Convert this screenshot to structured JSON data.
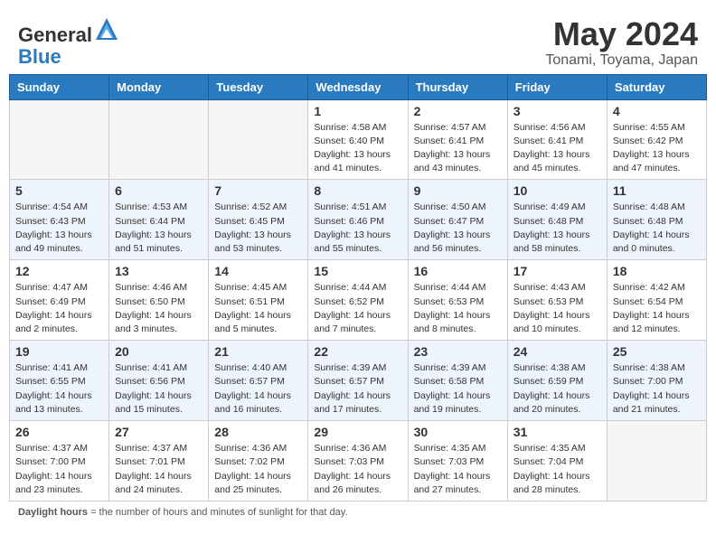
{
  "header": {
    "logo_line1": "General",
    "logo_line2": "Blue",
    "month": "May 2024",
    "location": "Tonami, Toyama, Japan"
  },
  "weekdays": [
    "Sunday",
    "Monday",
    "Tuesday",
    "Wednesday",
    "Thursday",
    "Friday",
    "Saturday"
  ],
  "weeks": [
    [
      {
        "day": "",
        "info": ""
      },
      {
        "day": "",
        "info": ""
      },
      {
        "day": "",
        "info": ""
      },
      {
        "day": "1",
        "info": "Sunrise: 4:58 AM\nSunset: 6:40 PM\nDaylight: 13 hours\nand 41 minutes."
      },
      {
        "day": "2",
        "info": "Sunrise: 4:57 AM\nSunset: 6:41 PM\nDaylight: 13 hours\nand 43 minutes."
      },
      {
        "day": "3",
        "info": "Sunrise: 4:56 AM\nSunset: 6:41 PM\nDaylight: 13 hours\nand 45 minutes."
      },
      {
        "day": "4",
        "info": "Sunrise: 4:55 AM\nSunset: 6:42 PM\nDaylight: 13 hours\nand 47 minutes."
      }
    ],
    [
      {
        "day": "5",
        "info": "Sunrise: 4:54 AM\nSunset: 6:43 PM\nDaylight: 13 hours\nand 49 minutes."
      },
      {
        "day": "6",
        "info": "Sunrise: 4:53 AM\nSunset: 6:44 PM\nDaylight: 13 hours\nand 51 minutes."
      },
      {
        "day": "7",
        "info": "Sunrise: 4:52 AM\nSunset: 6:45 PM\nDaylight: 13 hours\nand 53 minutes."
      },
      {
        "day": "8",
        "info": "Sunrise: 4:51 AM\nSunset: 6:46 PM\nDaylight: 13 hours\nand 55 minutes."
      },
      {
        "day": "9",
        "info": "Sunrise: 4:50 AM\nSunset: 6:47 PM\nDaylight: 13 hours\nand 56 minutes."
      },
      {
        "day": "10",
        "info": "Sunrise: 4:49 AM\nSunset: 6:48 PM\nDaylight: 13 hours\nand 58 minutes."
      },
      {
        "day": "11",
        "info": "Sunrise: 4:48 AM\nSunset: 6:48 PM\nDaylight: 14 hours\nand 0 minutes."
      }
    ],
    [
      {
        "day": "12",
        "info": "Sunrise: 4:47 AM\nSunset: 6:49 PM\nDaylight: 14 hours\nand 2 minutes."
      },
      {
        "day": "13",
        "info": "Sunrise: 4:46 AM\nSunset: 6:50 PM\nDaylight: 14 hours\nand 3 minutes."
      },
      {
        "day": "14",
        "info": "Sunrise: 4:45 AM\nSunset: 6:51 PM\nDaylight: 14 hours\nand 5 minutes."
      },
      {
        "day": "15",
        "info": "Sunrise: 4:44 AM\nSunset: 6:52 PM\nDaylight: 14 hours\nand 7 minutes."
      },
      {
        "day": "16",
        "info": "Sunrise: 4:44 AM\nSunset: 6:53 PM\nDaylight: 14 hours\nand 8 minutes."
      },
      {
        "day": "17",
        "info": "Sunrise: 4:43 AM\nSunset: 6:53 PM\nDaylight: 14 hours\nand 10 minutes."
      },
      {
        "day": "18",
        "info": "Sunrise: 4:42 AM\nSunset: 6:54 PM\nDaylight: 14 hours\nand 12 minutes."
      }
    ],
    [
      {
        "day": "19",
        "info": "Sunrise: 4:41 AM\nSunset: 6:55 PM\nDaylight: 14 hours\nand 13 minutes."
      },
      {
        "day": "20",
        "info": "Sunrise: 4:41 AM\nSunset: 6:56 PM\nDaylight: 14 hours\nand 15 minutes."
      },
      {
        "day": "21",
        "info": "Sunrise: 4:40 AM\nSunset: 6:57 PM\nDaylight: 14 hours\nand 16 minutes."
      },
      {
        "day": "22",
        "info": "Sunrise: 4:39 AM\nSunset: 6:57 PM\nDaylight: 14 hours\nand 17 minutes."
      },
      {
        "day": "23",
        "info": "Sunrise: 4:39 AM\nSunset: 6:58 PM\nDaylight: 14 hours\nand 19 minutes."
      },
      {
        "day": "24",
        "info": "Sunrise: 4:38 AM\nSunset: 6:59 PM\nDaylight: 14 hours\nand 20 minutes."
      },
      {
        "day": "25",
        "info": "Sunrise: 4:38 AM\nSunset: 7:00 PM\nDaylight: 14 hours\nand 21 minutes."
      }
    ],
    [
      {
        "day": "26",
        "info": "Sunrise: 4:37 AM\nSunset: 7:00 PM\nDaylight: 14 hours\nand 23 minutes."
      },
      {
        "day": "27",
        "info": "Sunrise: 4:37 AM\nSunset: 7:01 PM\nDaylight: 14 hours\nand 24 minutes."
      },
      {
        "day": "28",
        "info": "Sunrise: 4:36 AM\nSunset: 7:02 PM\nDaylight: 14 hours\nand 25 minutes."
      },
      {
        "day": "29",
        "info": "Sunrise: 4:36 AM\nSunset: 7:03 PM\nDaylight: 14 hours\nand 26 minutes."
      },
      {
        "day": "30",
        "info": "Sunrise: 4:35 AM\nSunset: 7:03 PM\nDaylight: 14 hours\nand 27 minutes."
      },
      {
        "day": "31",
        "info": "Sunrise: 4:35 AM\nSunset: 7:04 PM\nDaylight: 14 hours\nand 28 minutes."
      },
      {
        "day": "",
        "info": ""
      }
    ]
  ],
  "footer": {
    "label": "Daylight hours"
  }
}
